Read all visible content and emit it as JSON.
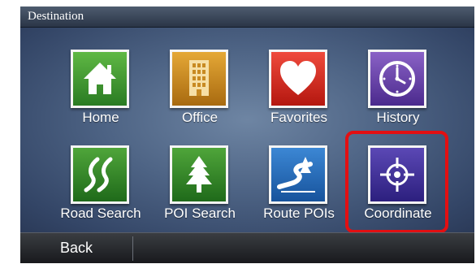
{
  "header": {
    "title": "Destination"
  },
  "tiles": [
    {
      "label": "Home",
      "icon": "home-icon",
      "color": "#4aa034"
    },
    {
      "label": "Office",
      "icon": "office-building-icon",
      "color": "#d7962b"
    },
    {
      "label": "Favorites",
      "icon": "heart-icon",
      "color": "#e1312a"
    },
    {
      "label": "History",
      "icon": "clock-icon",
      "color": "#6c46a9"
    },
    {
      "label": "Road Search",
      "icon": "road-icon",
      "color": "#3d9030"
    },
    {
      "label": "POI Search",
      "icon": "tree-icon",
      "color": "#3d9030"
    },
    {
      "label": "Route POIs",
      "icon": "route-icon",
      "color": "#2c72bd"
    },
    {
      "label": "Coordinate",
      "icon": "crosshair-icon",
      "color": "#43339e"
    }
  ],
  "footer": {
    "back_label": "Back"
  },
  "highlight_color": "#e30f12"
}
